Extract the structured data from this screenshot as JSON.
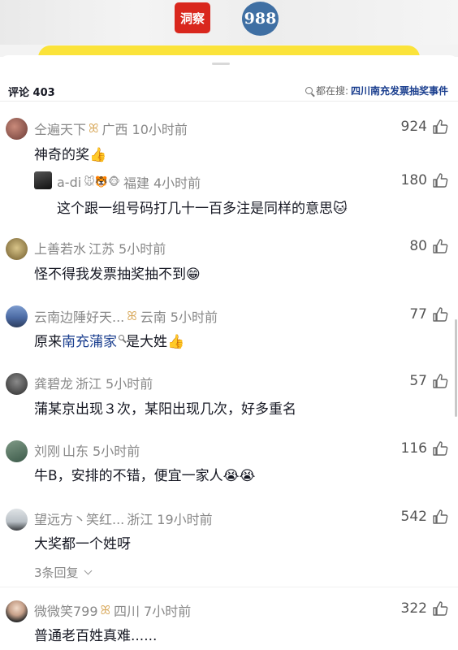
{
  "header": {
    "logo_red_text": "洞察",
    "logo_blue_text": "988"
  },
  "comments_header": {
    "count_label": "评论 403",
    "search_prefix": "都在搜:",
    "search_keyword": "四川南充发票抽奖事件"
  },
  "comments": [
    {
      "name": "仝遍天下",
      "badge": "ꕤ",
      "location": "广西",
      "time": "10小时前",
      "text": "神奇的奖",
      "emoji": "👍",
      "likes": "924"
    },
    {
      "name": "a-di",
      "badge": "🐭🐯🐵",
      "location": "福建",
      "time": "4小时前",
      "text": "这个跟一组号码打几十一百多注是同样的意思",
      "emoji": "🐱",
      "likes": "180"
    },
    {
      "name": "上善若水",
      "location": "江苏",
      "time": "5小时前",
      "text": "怪不得我发票抽奖抽不到",
      "emoji": "😁",
      "likes": "80"
    },
    {
      "name": "云南边陲好天...",
      "badge": "ꕤ",
      "location": "云南",
      "time": "5小时前",
      "text_prefix": "原来",
      "text_link": "南充蒲家",
      "text_suffix": "是大姓",
      "emoji": "👍",
      "likes": "77"
    },
    {
      "name": "龚碧龙",
      "location": "浙江",
      "time": "5小时前",
      "text": "蒲某京出现３次，某阳出现几次，好多重名",
      "likes": "57"
    },
    {
      "name": "刘刚",
      "location": "山东",
      "time": "5小时前",
      "text": "牛B，安排的不错，便宜一家人",
      "emoji": "😭😭",
      "likes": "116"
    },
    {
      "name": "望远方丶笑红...",
      "location": "浙江",
      "time": "19小时前",
      "text": "大奖都一个姓呀",
      "likes": "542",
      "replies": "3条回复"
    },
    {
      "name": "微微笑799",
      "badge": "ꕤ",
      "location": "四川",
      "time": "7小时前",
      "text": "普通老百姓真难......",
      "likes": "322"
    }
  ]
}
